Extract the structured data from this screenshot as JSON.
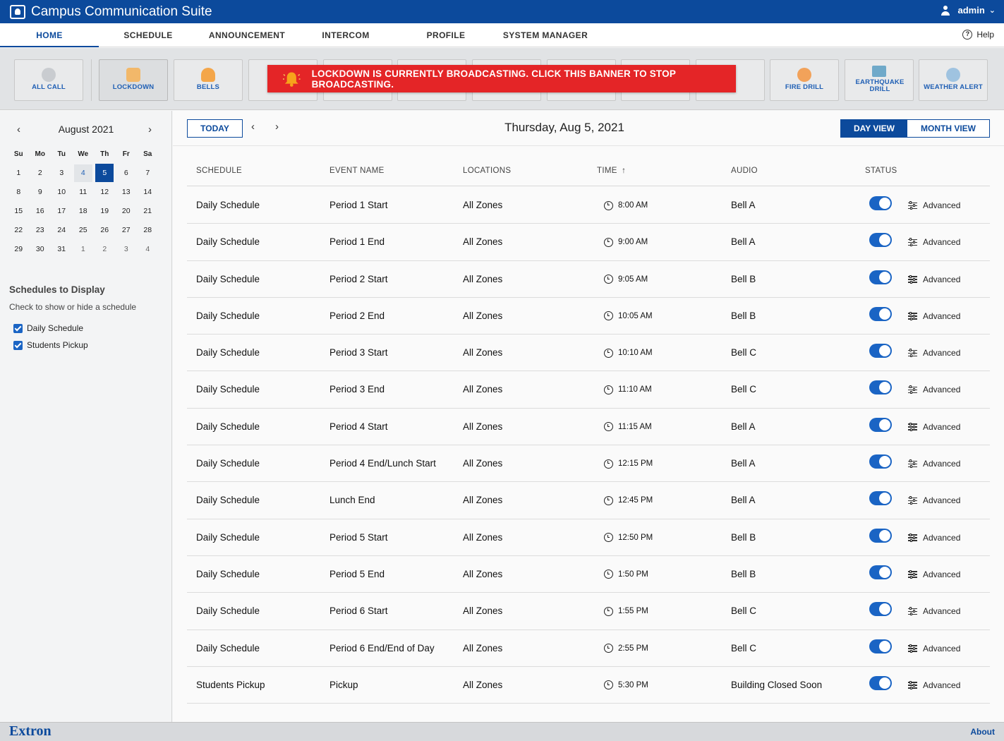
{
  "app": {
    "title": "Campus Communication Suite",
    "user": "admin",
    "help_label": "Help",
    "brand": "Extron",
    "about_label": "About"
  },
  "nav": [
    {
      "label": "HOME",
      "active": true
    },
    {
      "label": "SCHEDULE",
      "active": false
    },
    {
      "label": "ANNOUNCEMENT",
      "active": false
    },
    {
      "label": "INTERCOM",
      "active": false
    },
    {
      "label": "PROFILE",
      "active": false
    },
    {
      "label": "SYSTEM MANAGER",
      "active": false
    }
  ],
  "toolbar": {
    "buttons": [
      {
        "label": "ALL CALL",
        "icon": "microphone-icon",
        "color": "#c9ccd0"
      },
      {
        "label": "LOCKDOWN",
        "icon": "lock-icon",
        "color": "#f2b86a",
        "active": true
      },
      {
        "label": "BELLS",
        "icon": "bell-icon",
        "color": "#f4a64a"
      },
      {
        "label": "FIRE DRILL",
        "icon": "fire-icon",
        "color": "#f2a25a"
      },
      {
        "label": "EARTHQUAKE DRILL",
        "icon": "earthquake-icon",
        "color": "#6fa9c9"
      },
      {
        "label": "WEATHER ALERT",
        "icon": "weather-icon",
        "color": "#9fc3e0"
      }
    ]
  },
  "banner": {
    "text": "LOCKDOWN IS CURRENTLY BROADCASTING. CLICK THIS BANNER TO STOP BROADCASTING.",
    "color": "#e42527"
  },
  "calendar": {
    "month_label": "August 2021",
    "days_of_week": [
      "Su",
      "Mo",
      "Tu",
      "We",
      "Th",
      "Fr",
      "Sa"
    ],
    "weeks": [
      [
        "1",
        "2",
        "3",
        "4",
        "5",
        "6",
        "7"
      ],
      [
        "8",
        "9",
        "10",
        "11",
        "12",
        "13",
        "14"
      ],
      [
        "15",
        "16",
        "17",
        "18",
        "19",
        "20",
        "21"
      ],
      [
        "22",
        "23",
        "24",
        "25",
        "26",
        "27",
        "28"
      ],
      [
        "29",
        "30",
        "31",
        "1",
        "2",
        "3",
        "4"
      ]
    ],
    "today": "4",
    "selected": "5"
  },
  "schedules_panel": {
    "title": "Schedules to Display",
    "subtitle": "Check to show or hide a schedule",
    "items": [
      {
        "label": "Daily Schedule",
        "checked": true
      },
      {
        "label": "Students Pickup",
        "checked": true
      }
    ]
  },
  "main": {
    "today_label": "TODAY",
    "date_title": "Thursday, Aug 5, 2021",
    "day_view_label": "DAY VIEW",
    "month_view_label": "MONTH VIEW",
    "columns": {
      "schedule": "SCHEDULE",
      "event": "EVENT NAME",
      "locations": "LOCATIONS",
      "time": "TIME",
      "audio": "AUDIO",
      "status": "STATUS"
    },
    "advanced_label": "Advanced",
    "rows": [
      {
        "schedule": "Daily Schedule",
        "event": "Period 1 Start",
        "locations": "All Zones",
        "time": "8:00 AM",
        "audio": "Bell A",
        "enabled": true
      },
      {
        "schedule": "Daily Schedule",
        "event": "Period 1 End",
        "locations": "All Zones",
        "time": "9:00 AM",
        "audio": "Bell A",
        "enabled": true
      },
      {
        "schedule": "Daily Schedule",
        "event": "Period 2 Start",
        "locations": "All Zones",
        "time": "9:05 AM",
        "audio": "Bell B",
        "enabled": true
      },
      {
        "schedule": "Daily Schedule",
        "event": "Period 2 End",
        "locations": "All Zones",
        "time": "10:05 AM",
        "audio": "Bell B",
        "enabled": true
      },
      {
        "schedule": "Daily Schedule",
        "event": "Period 3 Start",
        "locations": "All Zones",
        "time": "10:10 AM",
        "audio": "Bell C",
        "enabled": true
      },
      {
        "schedule": "Daily Schedule",
        "event": "Period 3 End",
        "locations": "All Zones",
        "time": "11:10 AM",
        "audio": "Bell C",
        "enabled": true
      },
      {
        "schedule": "Daily Schedule",
        "event": "Period 4 Start",
        "locations": "All Zones",
        "time": "11:15 AM",
        "audio": "Bell A",
        "enabled": true
      },
      {
        "schedule": "Daily Schedule",
        "event": "Period 4 End/Lunch Start",
        "locations": "All Zones",
        "time": "12:15 PM",
        "audio": "Bell A",
        "enabled": true
      },
      {
        "schedule": "Daily Schedule",
        "event": "Lunch End",
        "locations": "All Zones",
        "time": "12:45 PM",
        "audio": "Bell A",
        "enabled": true
      },
      {
        "schedule": "Daily Schedule",
        "event": "Period 5 Start",
        "locations": "All Zones",
        "time": "12:50 PM",
        "audio": "Bell B",
        "enabled": true
      },
      {
        "schedule": "Daily Schedule",
        "event": "Period 5 End",
        "locations": "All Zones",
        "time": "1:50 PM",
        "audio": "Bell B",
        "enabled": true
      },
      {
        "schedule": "Daily Schedule",
        "event": "Period 6 Start",
        "locations": "All Zones",
        "time": "1:55 PM",
        "audio": "Bell C",
        "enabled": true
      },
      {
        "schedule": "Daily Schedule",
        "event": "Period 6 End/End of Day",
        "locations": "All Zones",
        "time": "2:55 PM",
        "audio": "Bell C",
        "enabled": true
      },
      {
        "schedule": "Students Pickup",
        "event": "Pickup",
        "locations": "All Zones",
        "time": "5:30 PM",
        "audio": "Building Closed Soon",
        "enabled": true
      }
    ]
  }
}
